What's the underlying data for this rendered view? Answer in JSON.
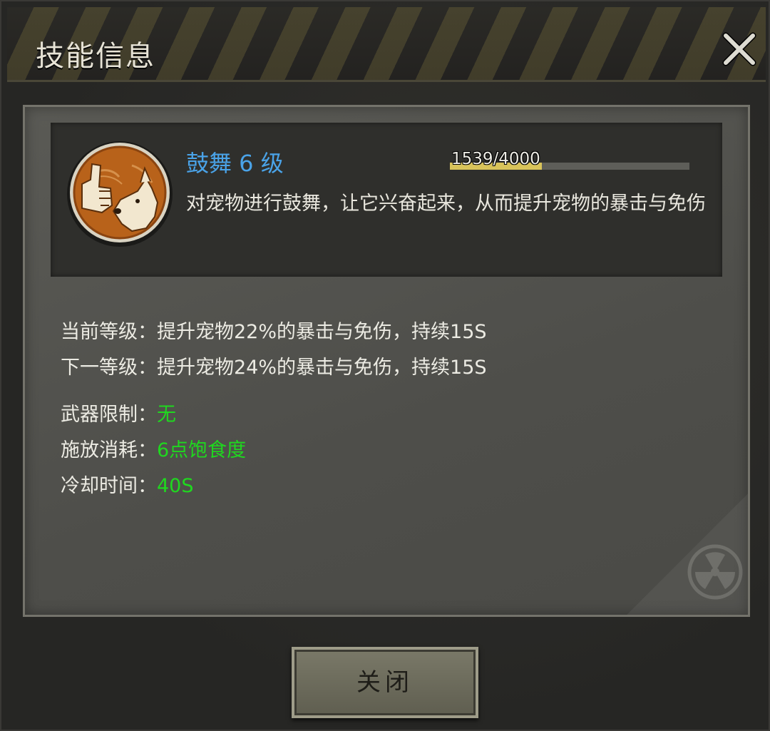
{
  "dialog": {
    "title": "技能信息",
    "close_icon": "close-icon"
  },
  "skill": {
    "name": "鼓舞 6 级",
    "icon": "thumbs-up-dog-icon",
    "xp_text": "1539/4000",
    "xp_current": 1539,
    "xp_max": 4000,
    "description": "对宠物进行鼓舞，让它兴奋起来，从而提升宠物的暴击与免伤"
  },
  "effects": {
    "current_label": "当前等级：",
    "current_value": "提升宠物22%的暴击与免伤，持续15S",
    "next_label": "下一等级：",
    "next_value": "提升宠物24%的暴击与免伤，持续15S"
  },
  "stats": {
    "weapon_label": "武器限制：",
    "weapon_value": "无",
    "cost_label": "施放消耗：",
    "cost_value": "6点饱食度",
    "cooldown_label": "冷却时间：",
    "cooldown_value": "40S"
  },
  "footer": {
    "close_label": "关闭"
  },
  "colors": {
    "skill_name": "#4aa3e8",
    "stat_value": "#1fd81f",
    "xp_fill": "#d8c35a"
  }
}
